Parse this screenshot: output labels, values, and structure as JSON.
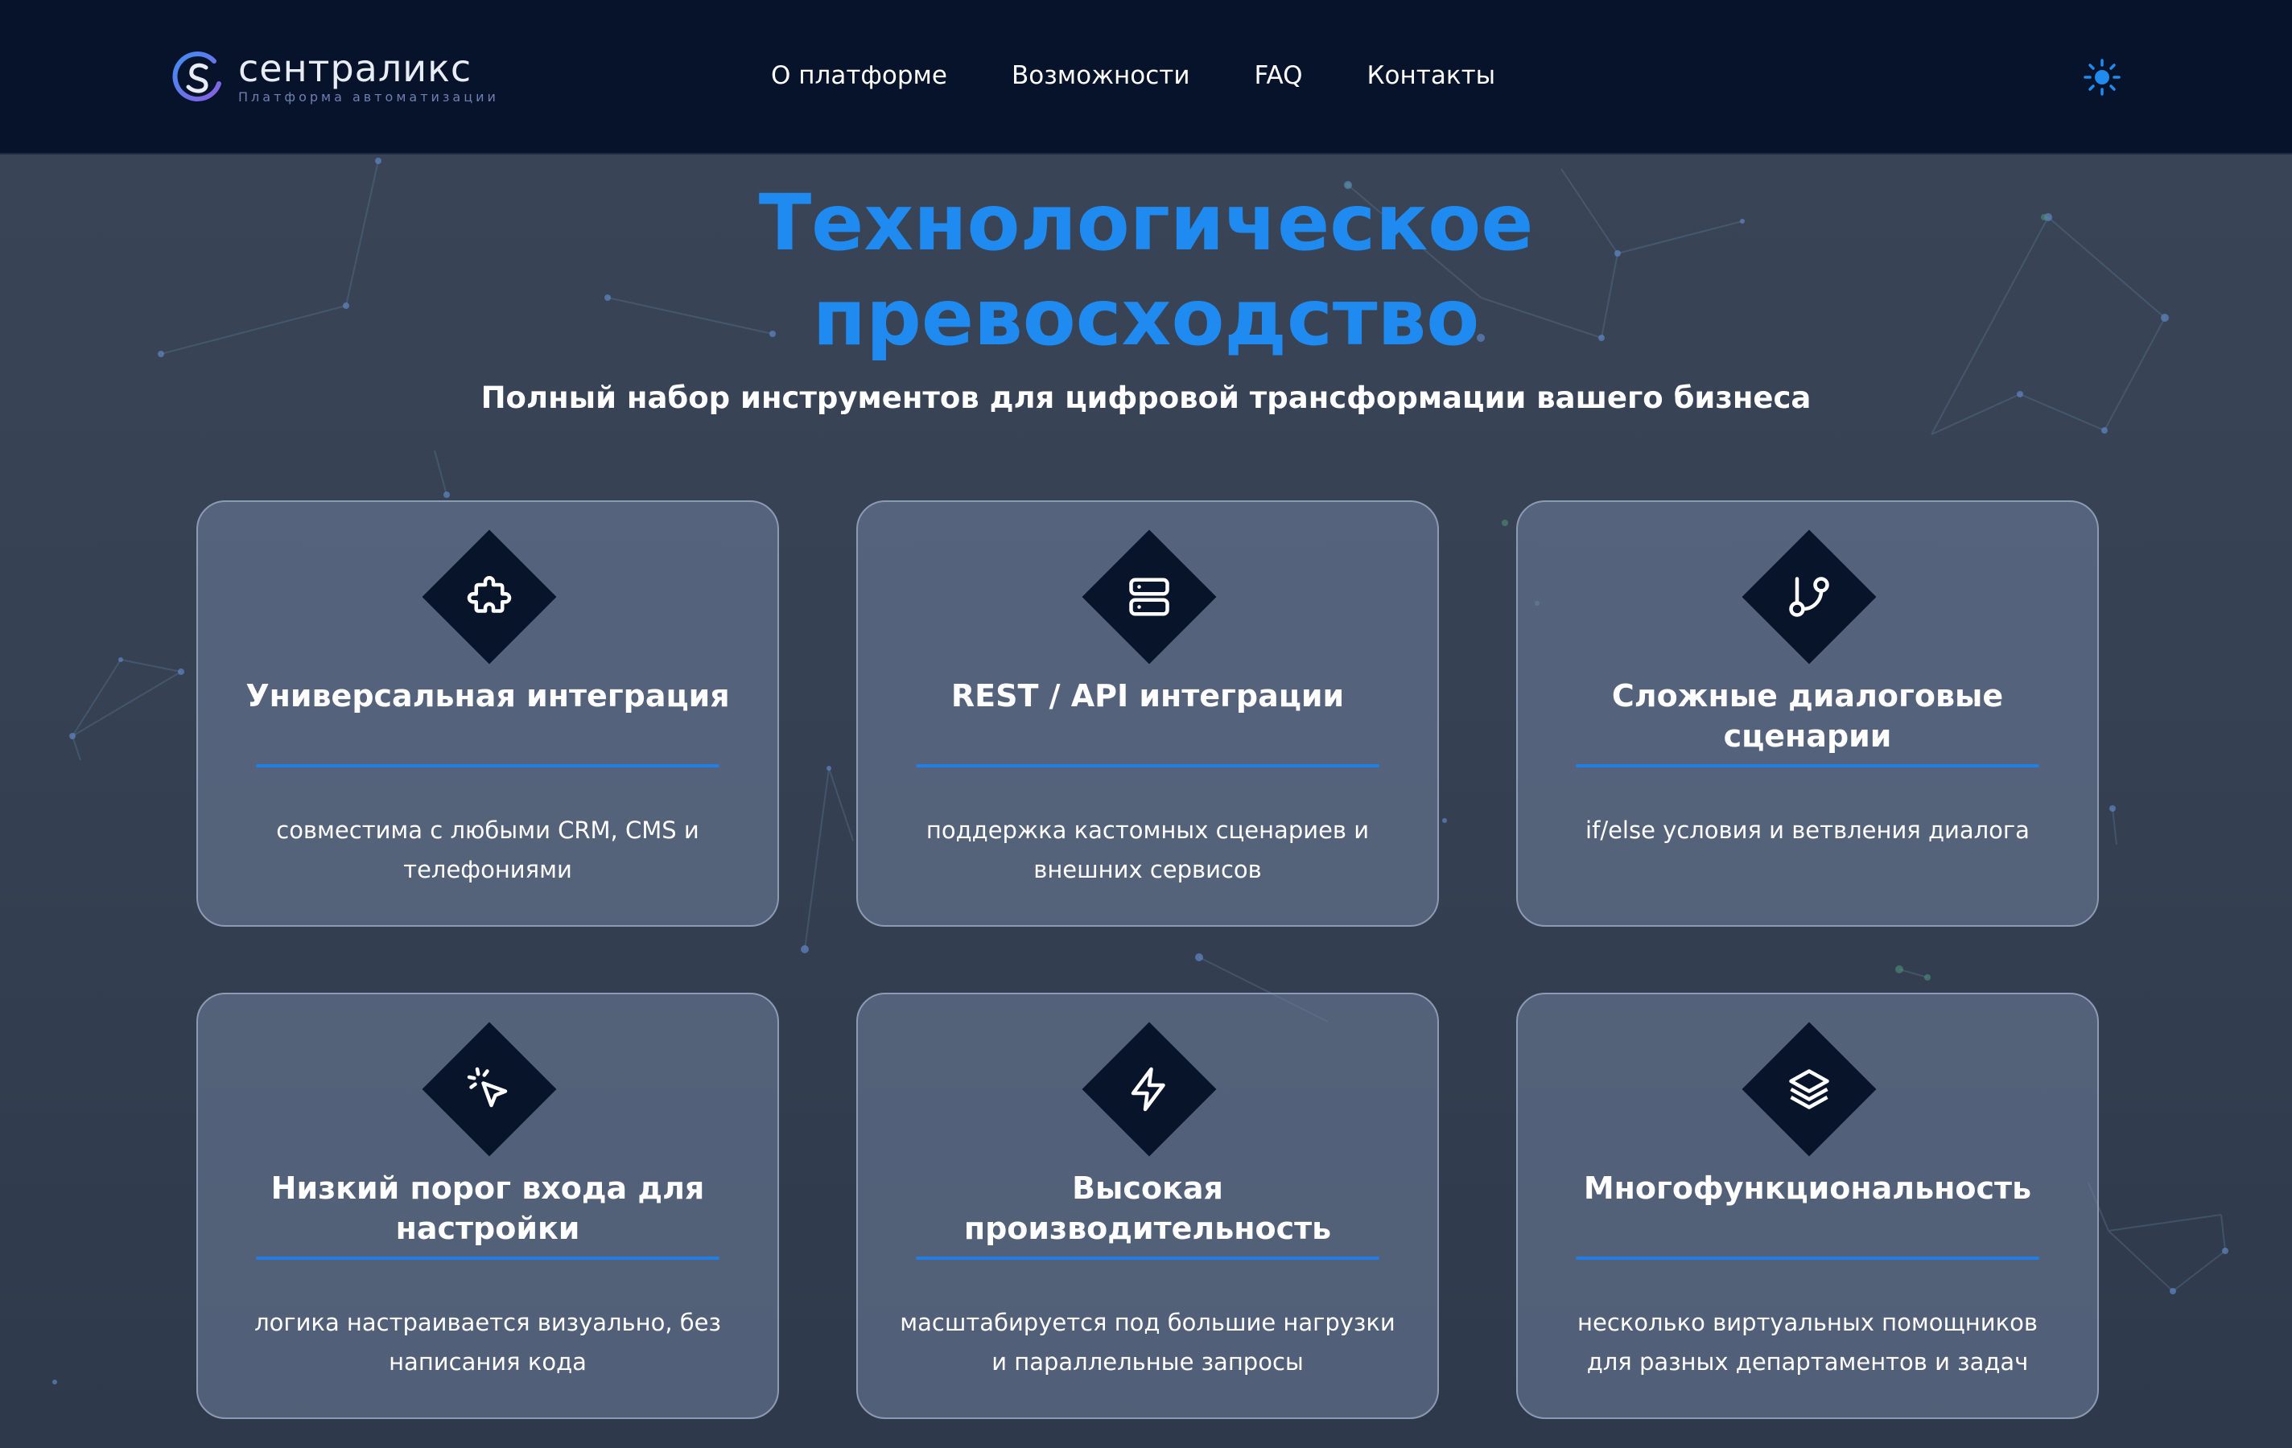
{
  "brand": {
    "name": "сентраликс",
    "tagline": "Платформа автоматизации"
  },
  "nav": {
    "items": [
      "О платформе",
      "Возможности",
      "FAQ",
      "Контакты"
    ]
  },
  "hero": {
    "title_line1": "Технологическое",
    "title_line2": "превосходство",
    "subtitle": "Полный набор инструментов для цифровой трансформации вашего бизнеса"
  },
  "features": [
    {
      "icon": "puzzle-icon",
      "title": "Универсальная интеграция",
      "description": "совместима с любыми CRM, CMS и телефониями"
    },
    {
      "icon": "server-icon",
      "title": "REST / API интеграции",
      "description": "поддержка кастомных сценариев и внешних сервисов"
    },
    {
      "icon": "git-branch-icon",
      "title": "Сложные диалоговые сценарии",
      "description": "if/else условия и ветвления диалога"
    },
    {
      "icon": "cursor-click-icon",
      "title": "Низкий порог входа для настройки",
      "description": "логика настраивается визуально, без написания кода"
    },
    {
      "icon": "lightning-icon",
      "title": "Высокая производительность",
      "description": "масштабируется под большие нагрузки и параллельные запросы"
    },
    {
      "icon": "layers-icon",
      "title": "Многофункциональность",
      "description": "несколько виртуальных помощников для разных департаментов и задач"
    }
  ],
  "theme": {
    "toggle_icon": "sun-icon"
  },
  "colors": {
    "header_bg": "#06132a",
    "page_bg": "#364253",
    "accent": "#1f8bf0",
    "card_bg": "#5f6b84",
    "icon_tile": "#071429"
  }
}
